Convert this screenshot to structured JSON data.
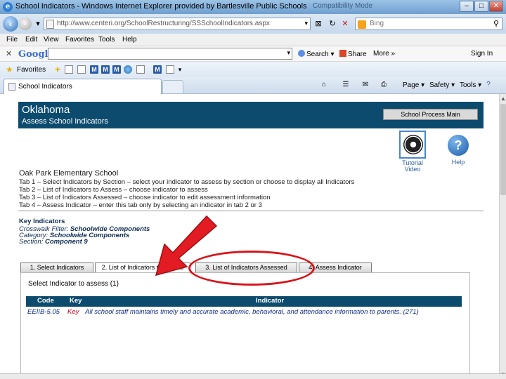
{
  "window": {
    "title": "School Indicators - Windows Internet Explorer provided by Bartlesville Public Schools",
    "compat_hint": "Compatibility Mode",
    "controls": [
      "–",
      "□",
      "✕"
    ]
  },
  "address": {
    "url": "http://www.centeri.org/SchoolRestructuring/SSSchoolIndicators.aspx",
    "search_placeholder": "Bing"
  },
  "menu": [
    "File",
    "Edit",
    "View",
    "Favorites",
    "Tools",
    "Help"
  ],
  "google_toolbar": {
    "logo": "Google",
    "search_label": "Search",
    "share_label": "Share",
    "more_label": "More »",
    "signin_label": "Sign In"
  },
  "favorites": {
    "label": "Favorites"
  },
  "command_bar": {
    "tab_label": "School Indicators",
    "page_label": "Page",
    "safety_label": "Safety",
    "tools_label": "Tools"
  },
  "page": {
    "state": "Oklahoma",
    "subtitle": "Assess School Indicators",
    "main_button": "School Process Main",
    "tutorial_label": "Tutorial Video",
    "help_label": "Help",
    "school_name": "Oak Park Elementary School",
    "tab_descriptions": [
      "Tab 1 – Select Indicators by Section – select your indicator to assess by section or choose to display all Indicators",
      "Tab 2 – List of Indicators to Assess – choose indicator to assess",
      "Tab 3 – List of Indicators Assessed – choose indicator to edit assessment information",
      "Tab 4 – Assess Indicator – enter this tab only by selecting an indicator in tab 2 or 3"
    ],
    "key_indicators_title": "Key Indicators",
    "crosswalk_label": "Crosswalk Filter:",
    "crosswalk_value": "Schoolwide Components",
    "category_label": "Category:",
    "category_value": "Schoolwide Components",
    "section_label": "Section:",
    "section_value": "Component 9",
    "tabs": [
      "1. Select Indicators",
      "2. List of Indicators to Assess",
      "3. List of Indicators Assessed",
      "4. Assess Indicator"
    ],
    "select_label": "Select Indicator to assess (1)",
    "table": {
      "headers": [
        "Code",
        "Key",
        "Indicator"
      ],
      "rows": [
        {
          "code": "EEIIB-5.05",
          "key": "Key",
          "indicator": "All school staff maintains timely and accurate academic, behavioral, and attendance information to parents. (271)"
        }
      ]
    }
  }
}
